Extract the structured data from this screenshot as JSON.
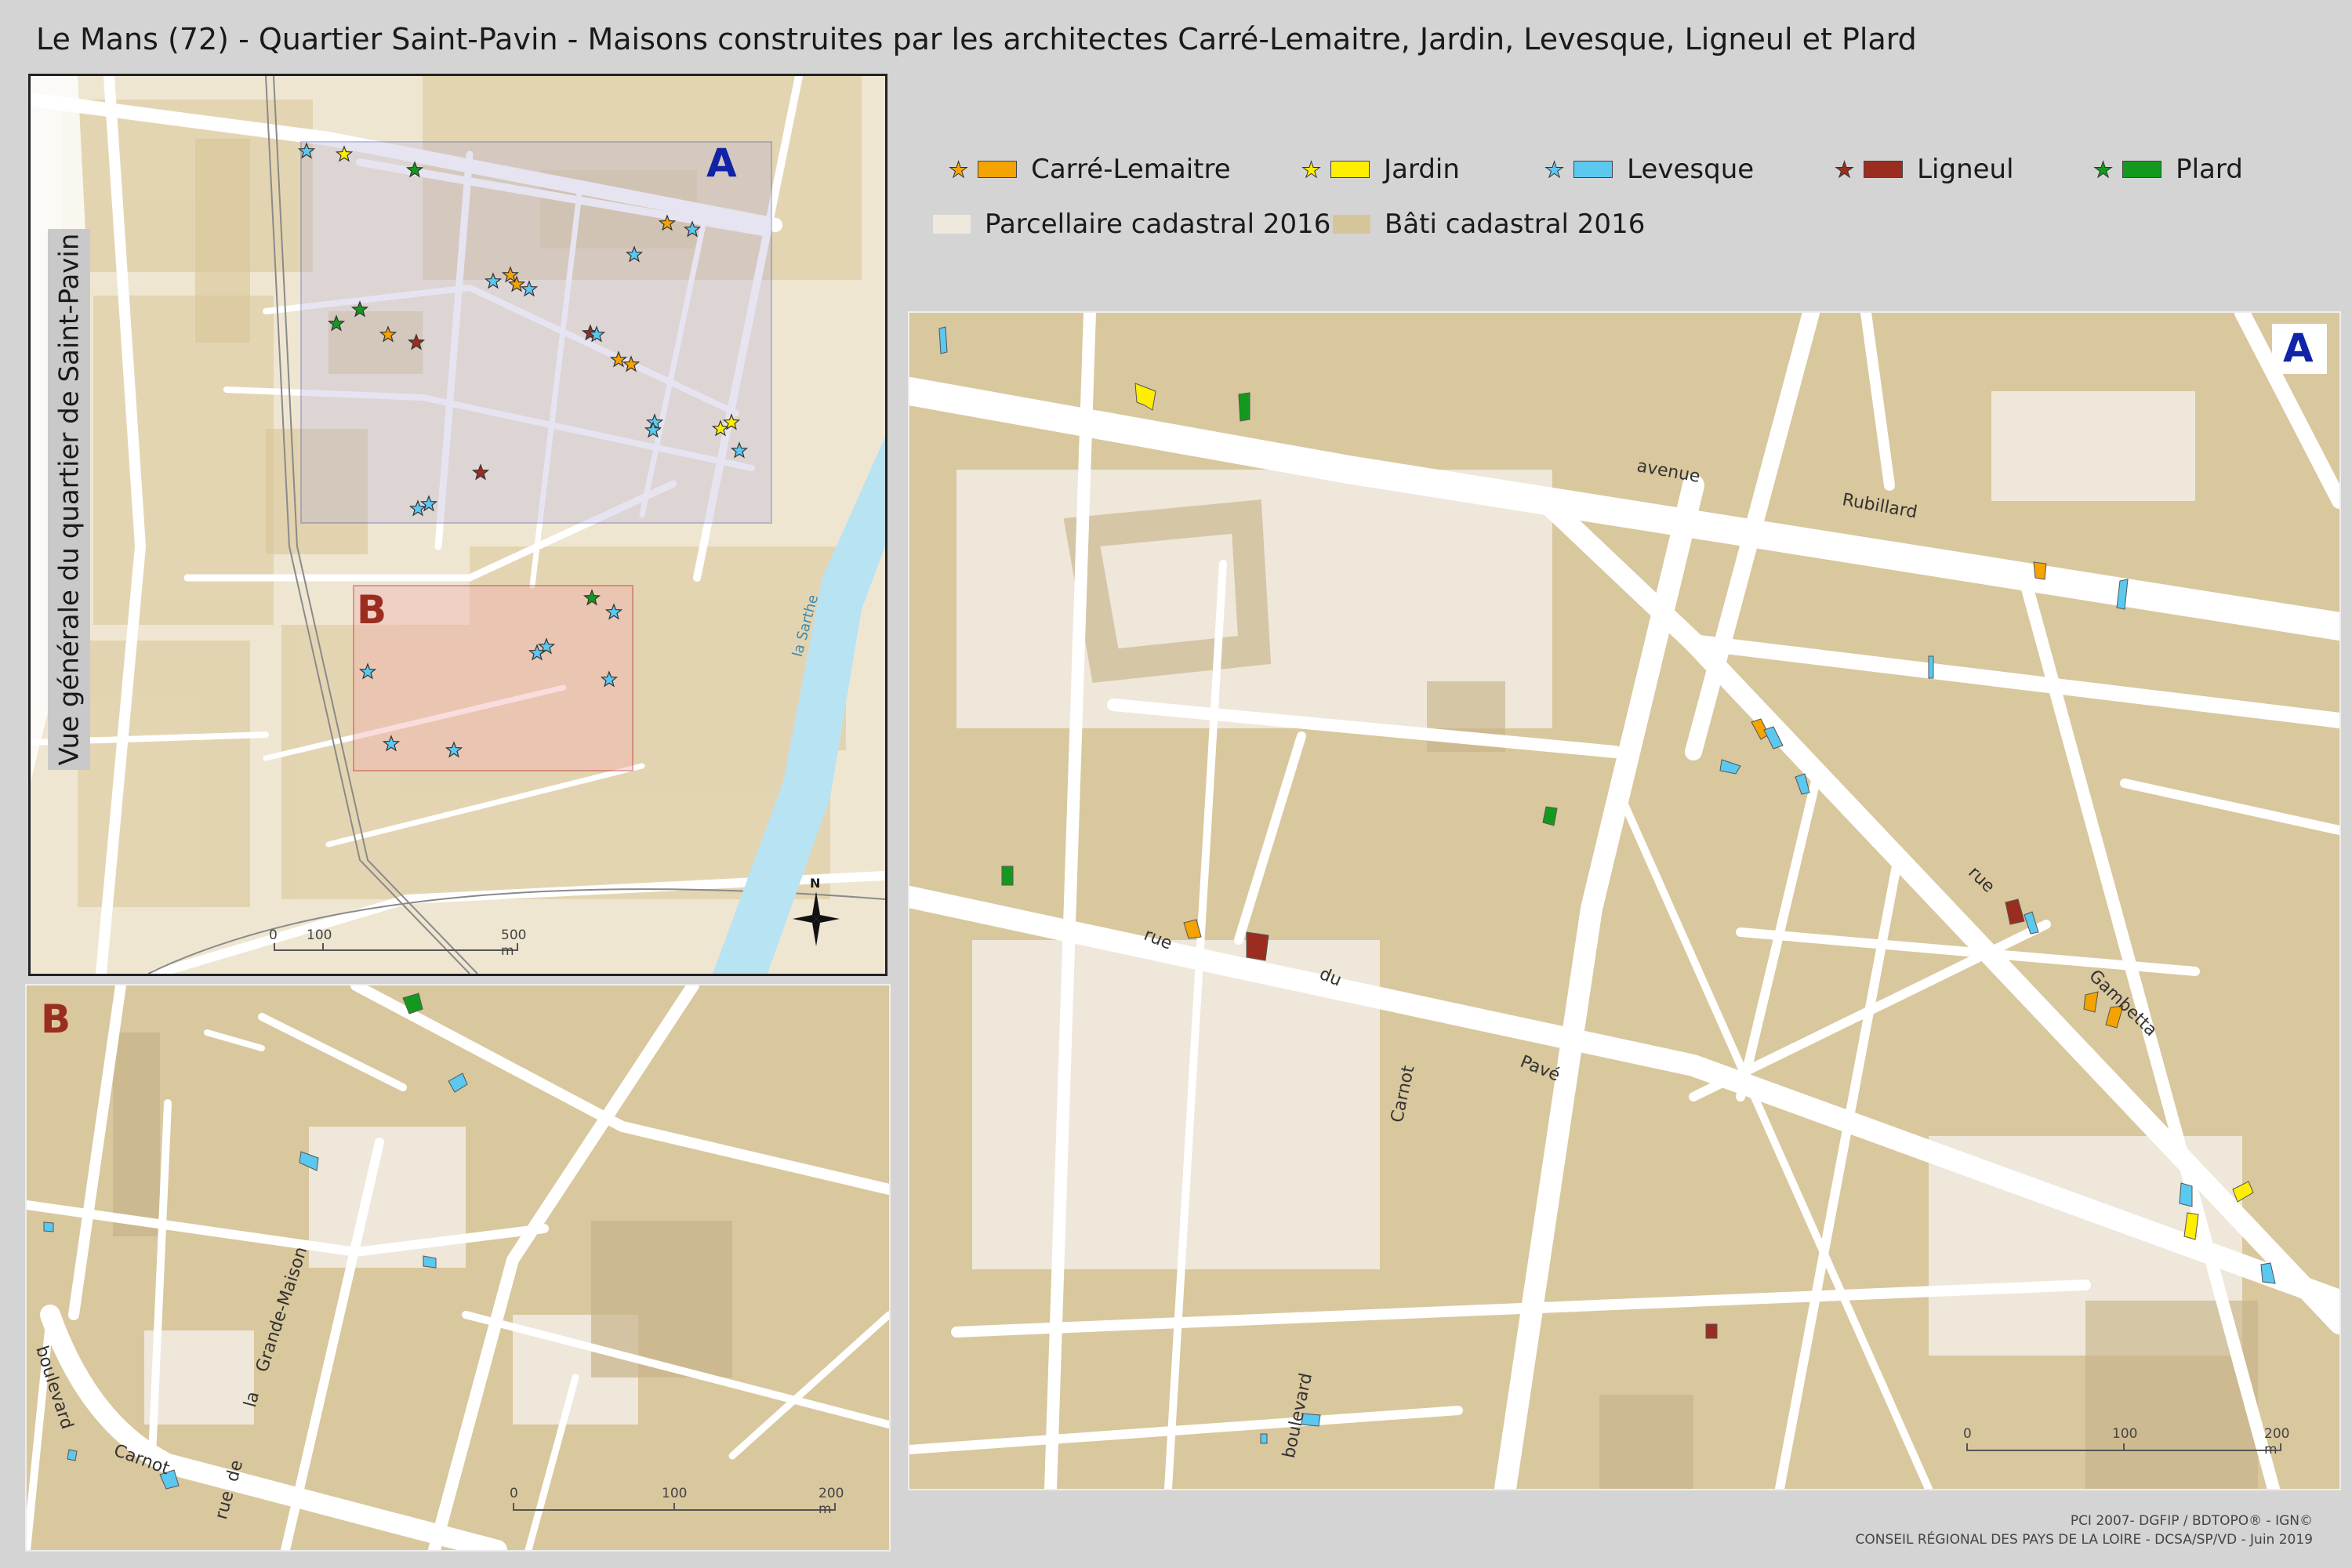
{
  "title": "Le Mans (72) - Quartier Saint-Pavin - Maisons construites par les architectes Carré-Lemaitre, Jardin, Levesque, Ligneul et Plard",
  "overview": {
    "label": "Vue générale du quartier de Saint-Pavin",
    "box_a_letter": "A",
    "box_b_letter": "B",
    "river_label": "la Sarthe",
    "north_label": "N",
    "scale": {
      "ticks": [
        "0",
        "100",
        "500 m"
      ]
    }
  },
  "legend": {
    "architects": [
      {
        "name": "Carré-Lemaitre",
        "color": "#f4a300"
      },
      {
        "name": "Jardin",
        "color": "#ffee00"
      },
      {
        "name": "Levesque",
        "color": "#5bc8f0"
      },
      {
        "name": "Ligneul",
        "color": "#9b2d20"
      },
      {
        "name": "Plard",
        "color": "#139a1e"
      }
    ],
    "layers": [
      {
        "name": "Parcellaire cadastral 2016",
        "color": "#efe9dd"
      },
      {
        "name": "Bâti cadastral 2016",
        "color": "#d6c49a"
      }
    ]
  },
  "panel_a": {
    "letter": "A",
    "streets": [
      "avenue",
      "Rubillard",
      "rue",
      "Gambetta",
      "rue",
      "du",
      "Pavé",
      "Carnot",
      "boulevard"
    ],
    "scale": {
      "ticks": [
        "0",
        "100",
        "200 m"
      ]
    }
  },
  "panel_b": {
    "letter": "B",
    "streets": [
      "boulevard",
      "Carnot",
      "rue",
      "de",
      "la",
      "Grande-Maison"
    ],
    "scale": {
      "ticks": [
        "0",
        "100",
        "200 m"
      ]
    }
  },
  "credits": [
    "PCI 2007- DGFIP / BDTOPO® - IGN©",
    "CONSEIL RÉGIONAL DES PAYS DE LA LOIRE - DCSA/SP/VD - Juin 2019"
  ]
}
